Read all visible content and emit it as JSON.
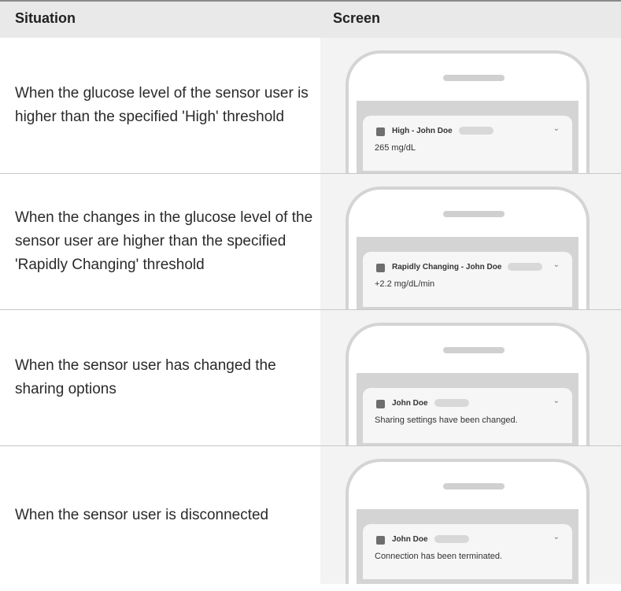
{
  "header": {
    "situation": "Situation",
    "screen": "Screen"
  },
  "rows": [
    {
      "situation": "When the glucose level of the sensor user is higher than the specified 'High' threshold",
      "notification": {
        "title": "High - John Doe",
        "body": "265 mg/dL"
      }
    },
    {
      "situation": "When the changes in the glucose level of the sensor user are higher than the specified 'Rapidly Changing' threshold",
      "notification": {
        "title": "Rapidly Changing - John Doe",
        "body": "+2.2 mg/dL/min"
      }
    },
    {
      "situation": "When the sensor user has changed the sharing options",
      "notification": {
        "title": "John Doe",
        "body": "Sharing settings have been changed."
      }
    },
    {
      "situation": "When the sensor user is disconnected",
      "notification": {
        "title": "John Doe",
        "body": "Connection has been terminated."
      }
    }
  ],
  "icons": {
    "expand": "chevron-down-icon",
    "app": "app-icon"
  }
}
